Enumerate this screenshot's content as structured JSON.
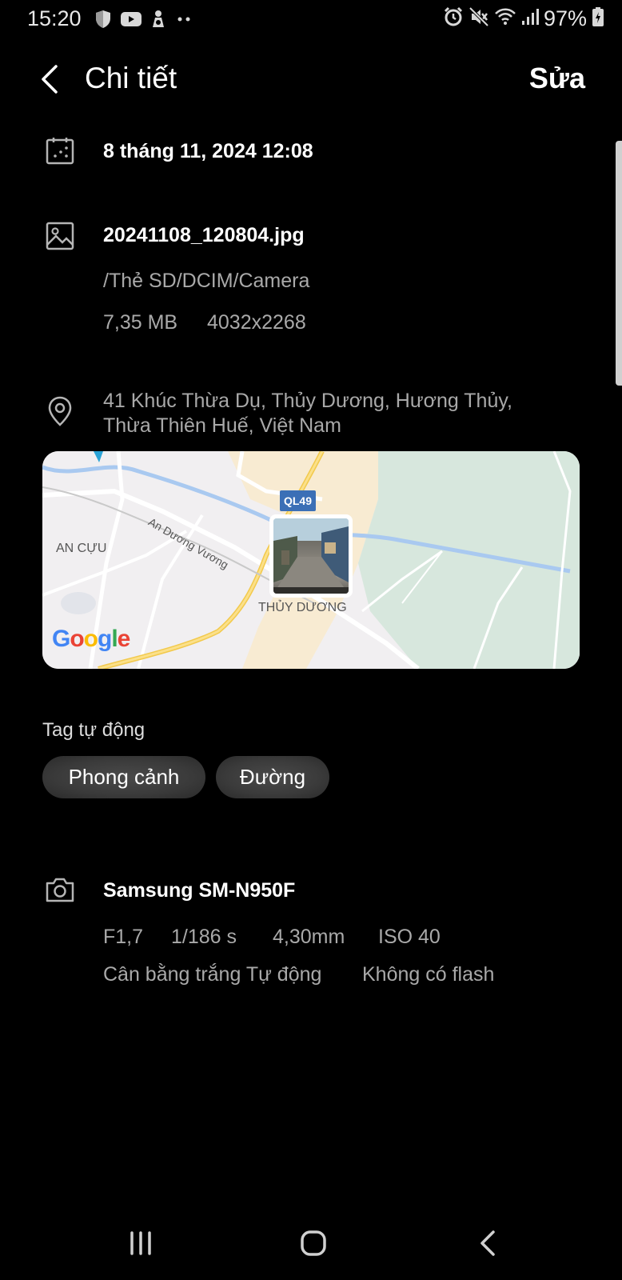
{
  "status_bar": {
    "time": "15:20",
    "battery_percent": "97%",
    "left_icons": [
      "shield-icon",
      "youtube-icon",
      "app-notification-icon",
      "more-dots-icon"
    ],
    "right_icons": [
      "alarm-icon",
      "mute-icon",
      "wifi-icon",
      "signal-icon",
      "battery-charging-icon"
    ]
  },
  "header": {
    "title": "Chi tiết",
    "edit_label": "Sửa"
  },
  "datetime": {
    "value": "8 tháng 11, 2024 12:08"
  },
  "file": {
    "name": "20241108_120804.jpg",
    "path": "/Thẻ SD/DCIM/Camera",
    "size": "7,35 MB",
    "resolution": "4032x2268"
  },
  "location": {
    "address_line1": "41 Khúc Thừa Dụ, Thủy Dương, Hương Thủy,",
    "address_line2": "Thừa Thiên Huế, Việt Nam",
    "map": {
      "label_area_1": "AN CỰU",
      "label_area_2": "THỦY DƯƠNG",
      "label_road": "An Dương Vương",
      "route_badge": "QL49",
      "provider": "Google"
    }
  },
  "tags": {
    "title": "Tag tự động",
    "items": [
      "Phong cảnh",
      "Đường"
    ]
  },
  "camera": {
    "model": "Samsung SM-N950F",
    "aperture": "F1,7",
    "shutter": "1/186 s",
    "focal_length": "4,30mm",
    "iso": "ISO 40",
    "white_balance": "Cân bằng trắng Tự động",
    "flash": "Không có flash"
  },
  "navbar": {
    "buttons": [
      "recent-apps",
      "home",
      "back"
    ]
  },
  "colors": {
    "background": "#000000",
    "primary_text": "#ffffff",
    "secondary_text": "#a9a9a9",
    "route_badge": "#3b6fb6"
  }
}
